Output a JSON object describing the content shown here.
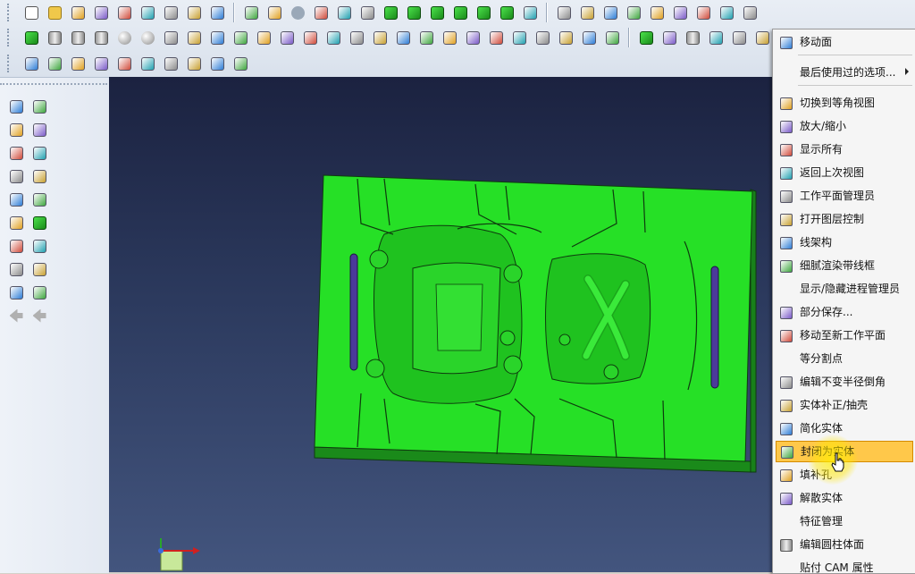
{
  "colors": {
    "part_green": "#26e026",
    "part_edge": "#0e3b0e",
    "viewport_top": "#1b2240",
    "viewport_bottom": "#43557e",
    "menu_highlight": "#ffc84a",
    "slot_purple": "#4b3a9a"
  },
  "toolbar": {
    "row1_icons": [
      "new-file-icon",
      "open-folder-icon",
      "import-icon",
      "save-icon",
      "save-as-icon",
      "export-icon",
      "print-icon",
      "zoom-icon",
      "layout-icon",
      "zoom-box-icon",
      "zoom-fit-icon",
      "arrow-icon",
      "refresh-icon",
      "view-face-icon",
      "render-icon",
      "cube-front-icon",
      "cube-back-icon",
      "cube-left-icon",
      "cube-right-icon",
      "cube-top-icon",
      "cube-solid-icon",
      "scale-1-1-icon",
      "edit-icon",
      "print-preview-icon",
      "palette-icon",
      "gear-icon",
      "traffic-light-icon",
      "filter-icon",
      "wizard-icon",
      "plus-icon",
      "settings-icon"
    ],
    "row2_icons": [
      "cube-icon",
      "cylinder-icon",
      "cone-icon",
      "pyramid-icon",
      "sphere-icon",
      "torus-icon",
      "union-icon",
      "subtract-icon",
      "intersect-icon",
      "box-icon",
      "sheet-icon",
      "sweep-icon",
      "extrude-icon",
      "revolve-icon",
      "draft-icon",
      "fillet-icon",
      "loft-icon",
      "hole-icon",
      "pocket-icon",
      "split-icon",
      "shell-icon",
      "chamfer-icon",
      "move-face-icon",
      "offset-icon",
      "replace-face-icon",
      "surface-icon",
      "cube-blue-icon",
      "box-front-icon",
      "cylinder-face-icon",
      "box-edge-icon",
      "box-view-icon",
      "box-icon"
    ],
    "row3_icons": [
      "surface-edit-icon",
      "diamond-icon",
      "cross-edit-icon",
      "figure-icon",
      "trim-icon",
      "patch-icon",
      "rainbow-icon",
      "magenta-shape-icon",
      "stack-icon",
      "wrap-icon"
    ]
  },
  "left_panel": {
    "icons": [
      "zoom-icon",
      "pin-icon",
      "fit-all-icon",
      "rotate-icon",
      "zoom-in-icon",
      "select-box-icon",
      "workplane-icon",
      "pencil-icon",
      "paint-icon",
      "plane-icon",
      "refresh-icon",
      "cube-icon",
      "help-icon",
      "bracket-icon",
      "trash-icon",
      "undo-icon",
      "image-icon",
      "edit-table-icon",
      "back-arrow-icon",
      "forward-arrow-icon"
    ]
  },
  "menu": {
    "items": [
      {
        "label": "移动面",
        "icon": "move-face-icon",
        "highlight": false,
        "submenu": false
      },
      {
        "label": "最后使用过的选项...",
        "icon": "",
        "highlight": false,
        "submenu": true
      },
      {
        "label": "切换到等角视图",
        "icon": "isometric-view-icon",
        "highlight": false,
        "submenu": false
      },
      {
        "label": "放大/缩小",
        "icon": "zoom-icon",
        "highlight": false,
        "submenu": false
      },
      {
        "label": "显示所有",
        "icon": "fit-all-icon",
        "highlight": false,
        "submenu": false
      },
      {
        "label": "返回上次视图",
        "icon": "previous-view-icon",
        "highlight": false,
        "submenu": false
      },
      {
        "label": "工作平面管理员",
        "icon": "workplane-icon",
        "highlight": false,
        "submenu": false
      },
      {
        "label": "打开图层控制",
        "icon": "layers-icon",
        "highlight": false,
        "submenu": false
      },
      {
        "label": "线架构",
        "icon": "wireframe-icon",
        "highlight": false,
        "submenu": false
      },
      {
        "label": "细腻渲染带线框",
        "icon": "shaded-wire-icon",
        "highlight": false,
        "submenu": false
      },
      {
        "label": "显示/隐藏进程管理员",
        "icon": "",
        "highlight": false,
        "submenu": false
      },
      {
        "label": "部分保存...",
        "icon": "partial-save-icon",
        "highlight": false,
        "submenu": false
      },
      {
        "label": "移动至新工作平面",
        "icon": "move-workplane-icon",
        "highlight": false,
        "submenu": false
      },
      {
        "label": "等分割点",
        "icon": "",
        "highlight": false,
        "submenu": false
      },
      {
        "label": "编辑不变半径倒角",
        "icon": "fillet-icon",
        "highlight": false,
        "submenu": false
      },
      {
        "label": "实体补正/抽壳",
        "icon": "shell-icon",
        "highlight": false,
        "submenu": false
      },
      {
        "label": "简化实体",
        "icon": "simplify-icon",
        "highlight": false,
        "submenu": false
      },
      {
        "label": "封闭为实体",
        "icon": "close-solid-icon",
        "highlight": true,
        "submenu": false
      },
      {
        "label": "填补孔",
        "icon": "fill-hole-icon",
        "highlight": false,
        "submenu": false
      },
      {
        "label": "解散实体",
        "icon": "dissolve-icon",
        "highlight": false,
        "submenu": false
      },
      {
        "label": "特征管理",
        "icon": "",
        "highlight": false,
        "submenu": false
      },
      {
        "label": "编辑圆柱体面",
        "icon": "cylinder-face-icon",
        "highlight": false,
        "submenu": false
      },
      {
        "label": "贴付 CAM 属性",
        "icon": "",
        "highlight": false,
        "submenu": false
      }
    ]
  }
}
